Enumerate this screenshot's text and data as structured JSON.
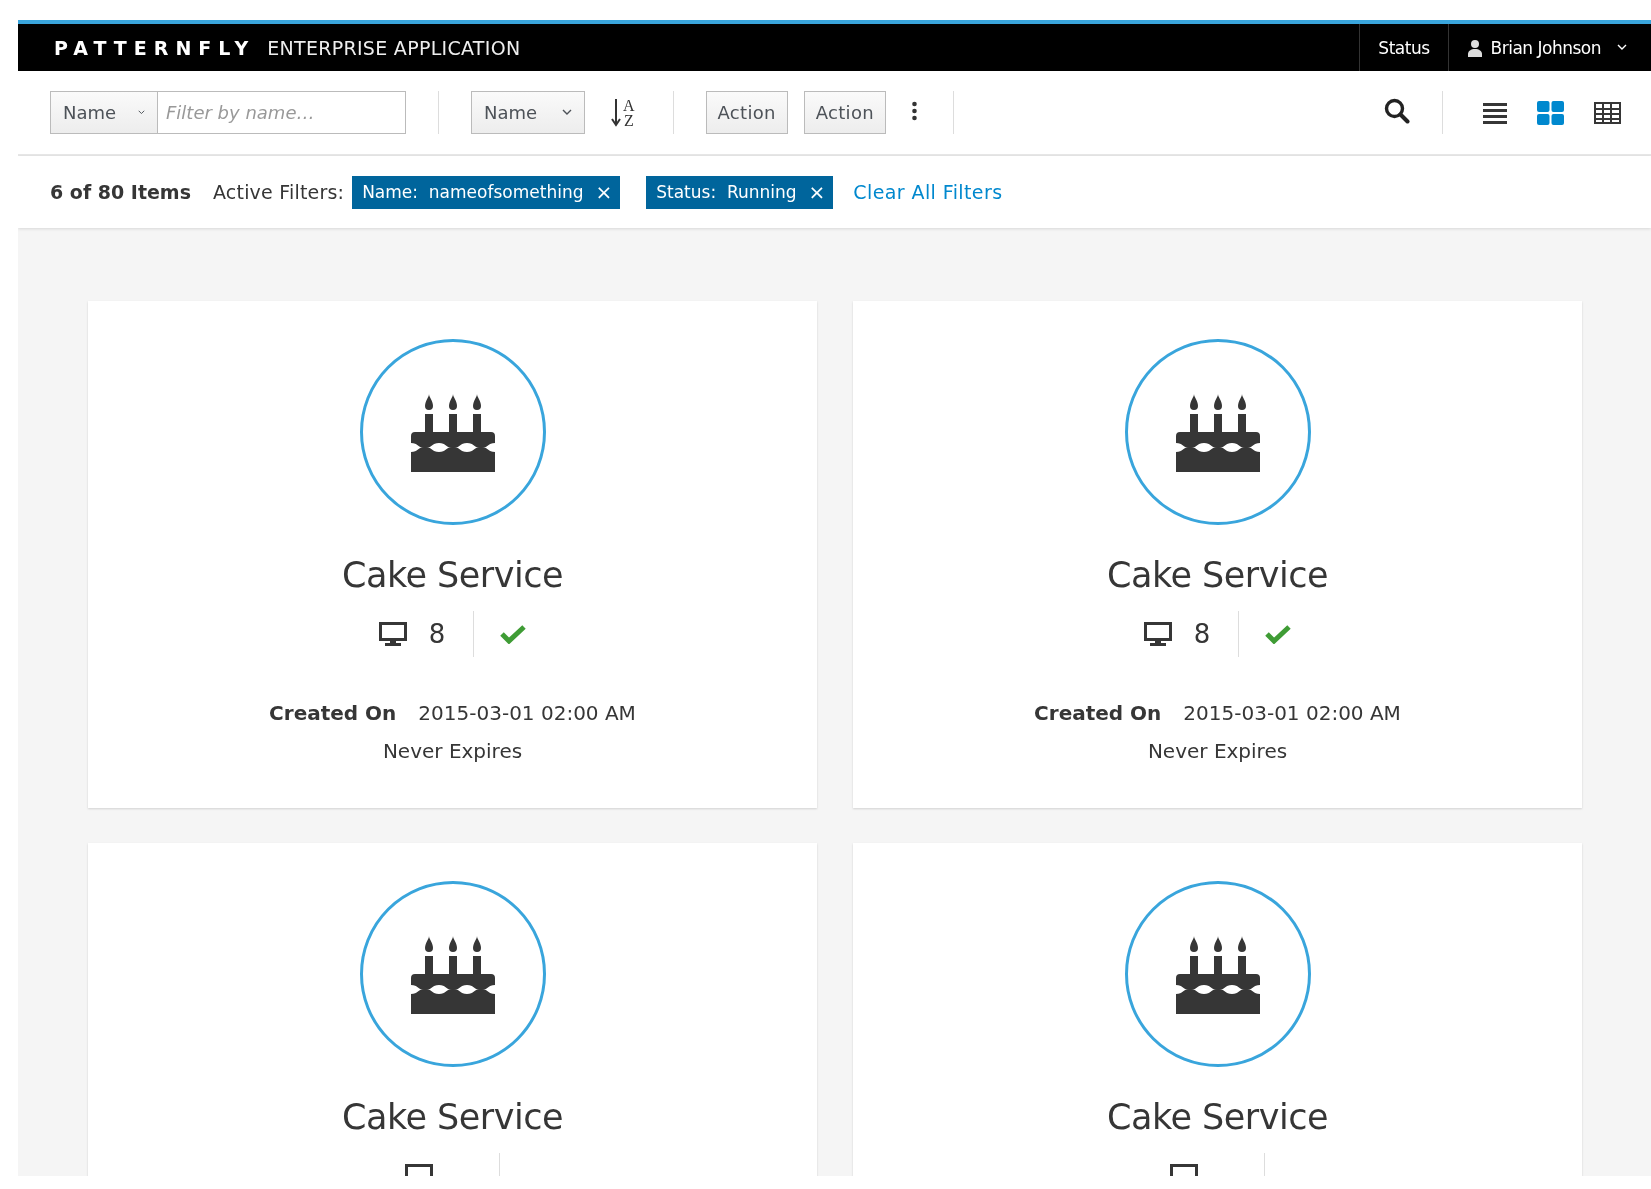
{
  "masthead": {
    "brand": "PATTERNFLY",
    "title": "ENTERPRISE APPLICATION",
    "status": "Status",
    "user": "Brian Johnson"
  },
  "toolbar": {
    "filter_field": "Name",
    "filter_placeholder": "Filter by name…",
    "sort_field": "Name",
    "sort_letters": [
      "A",
      "Z"
    ],
    "actions": [
      "Action",
      "Action"
    ],
    "views": [
      {
        "kind": "list",
        "selected": false
      },
      {
        "kind": "card",
        "selected": true
      },
      {
        "kind": "table",
        "selected": false
      }
    ]
  },
  "filter_bar": {
    "count": "6 of 80 Items",
    "label": "Active Filters:",
    "filters": [
      {
        "text": "Name:  nameofsomething",
        "remove": "×"
      },
      {
        "text": "Status:  Running",
        "remove": "×"
      }
    ],
    "clear": "Clear All Filters"
  },
  "cards": [
    {
      "title": "Cake Service",
      "count": "8",
      "status_ok": true,
      "created_label": "Created On",
      "created": "2015-03-01 02:00 AM",
      "expires": "Never Expires"
    },
    {
      "title": "Cake Service",
      "count": "8",
      "status_ok": true,
      "created_label": "Created On",
      "created": "2015-03-01 02:00 AM",
      "expires": "Never Expires"
    },
    {
      "title": "Cake Service"
    },
    {
      "title": "Cake Service"
    }
  ]
}
